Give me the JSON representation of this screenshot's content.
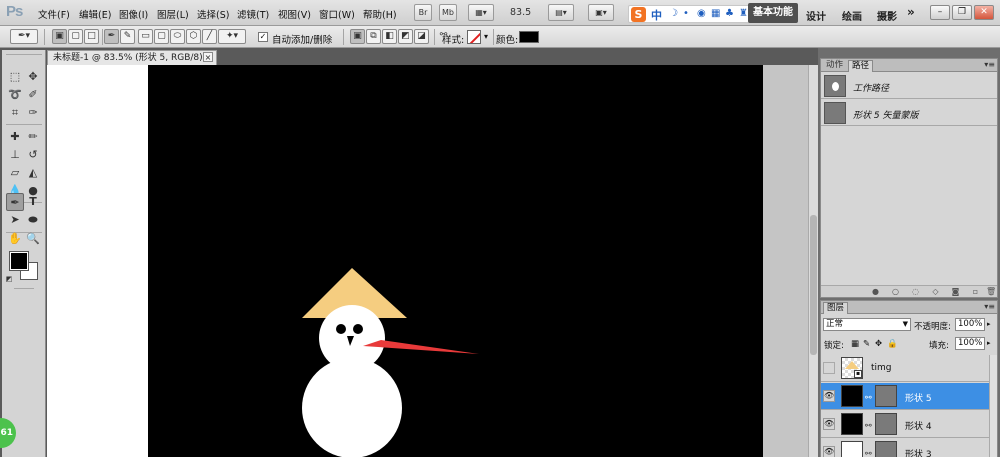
{
  "app": {
    "logo": "Ps"
  },
  "menu": [
    "文件(F)",
    "编辑(E)",
    "图像(I)",
    "图层(L)",
    "选择(S)",
    "滤镜(T)",
    "视图(V)",
    "窗口(W)",
    "帮助(H)"
  ],
  "menubar": {
    "bridge_label": "Br",
    "minibridge_label": "Mb",
    "zoom_level": "83.5",
    "ime": {
      "logo": "S",
      "lang": "中"
    },
    "workspaces": {
      "active": "基本功能",
      "items": [
        "设计",
        "绘画",
        "摄影"
      ],
      "more": "»"
    }
  },
  "options": {
    "auto_add_delete": "自动添加/删除",
    "style_label": "样式:",
    "color_label": "颜色:",
    "colors": {
      "fill": "#000000"
    }
  },
  "document": {
    "tab_title": "未标题-1 @ 83.5% (形状 5, RGB/8) *",
    "close_glyph": "×",
    "badge": "61"
  },
  "paths_panel": {
    "tabs": [
      "动作",
      "路径"
    ],
    "active_tab": 1,
    "items": [
      {
        "name": "工作路径"
      },
      {
        "name": "形状 5 矢量蒙版"
      }
    ]
  },
  "layers_panel": {
    "tab": "图层",
    "blend_mode": "正常",
    "opacity_label": "不透明度:",
    "opacity": "100%",
    "lock_label": "锁定:",
    "fill_label": "填充:",
    "fill": "100%",
    "layers": [
      {
        "name": "timg",
        "selected": false,
        "visible": false
      },
      {
        "name": "形状 5",
        "selected": true,
        "visible": true
      },
      {
        "name": "形状 4",
        "selected": false,
        "visible": true
      },
      {
        "name": "形状 3",
        "selected": false,
        "visible": true
      }
    ]
  },
  "canvas": {
    "colors": {
      "background": "#000000",
      "snow": "#ffffff",
      "hat": "#f5cd80",
      "nose": "#e83a3a"
    }
  }
}
